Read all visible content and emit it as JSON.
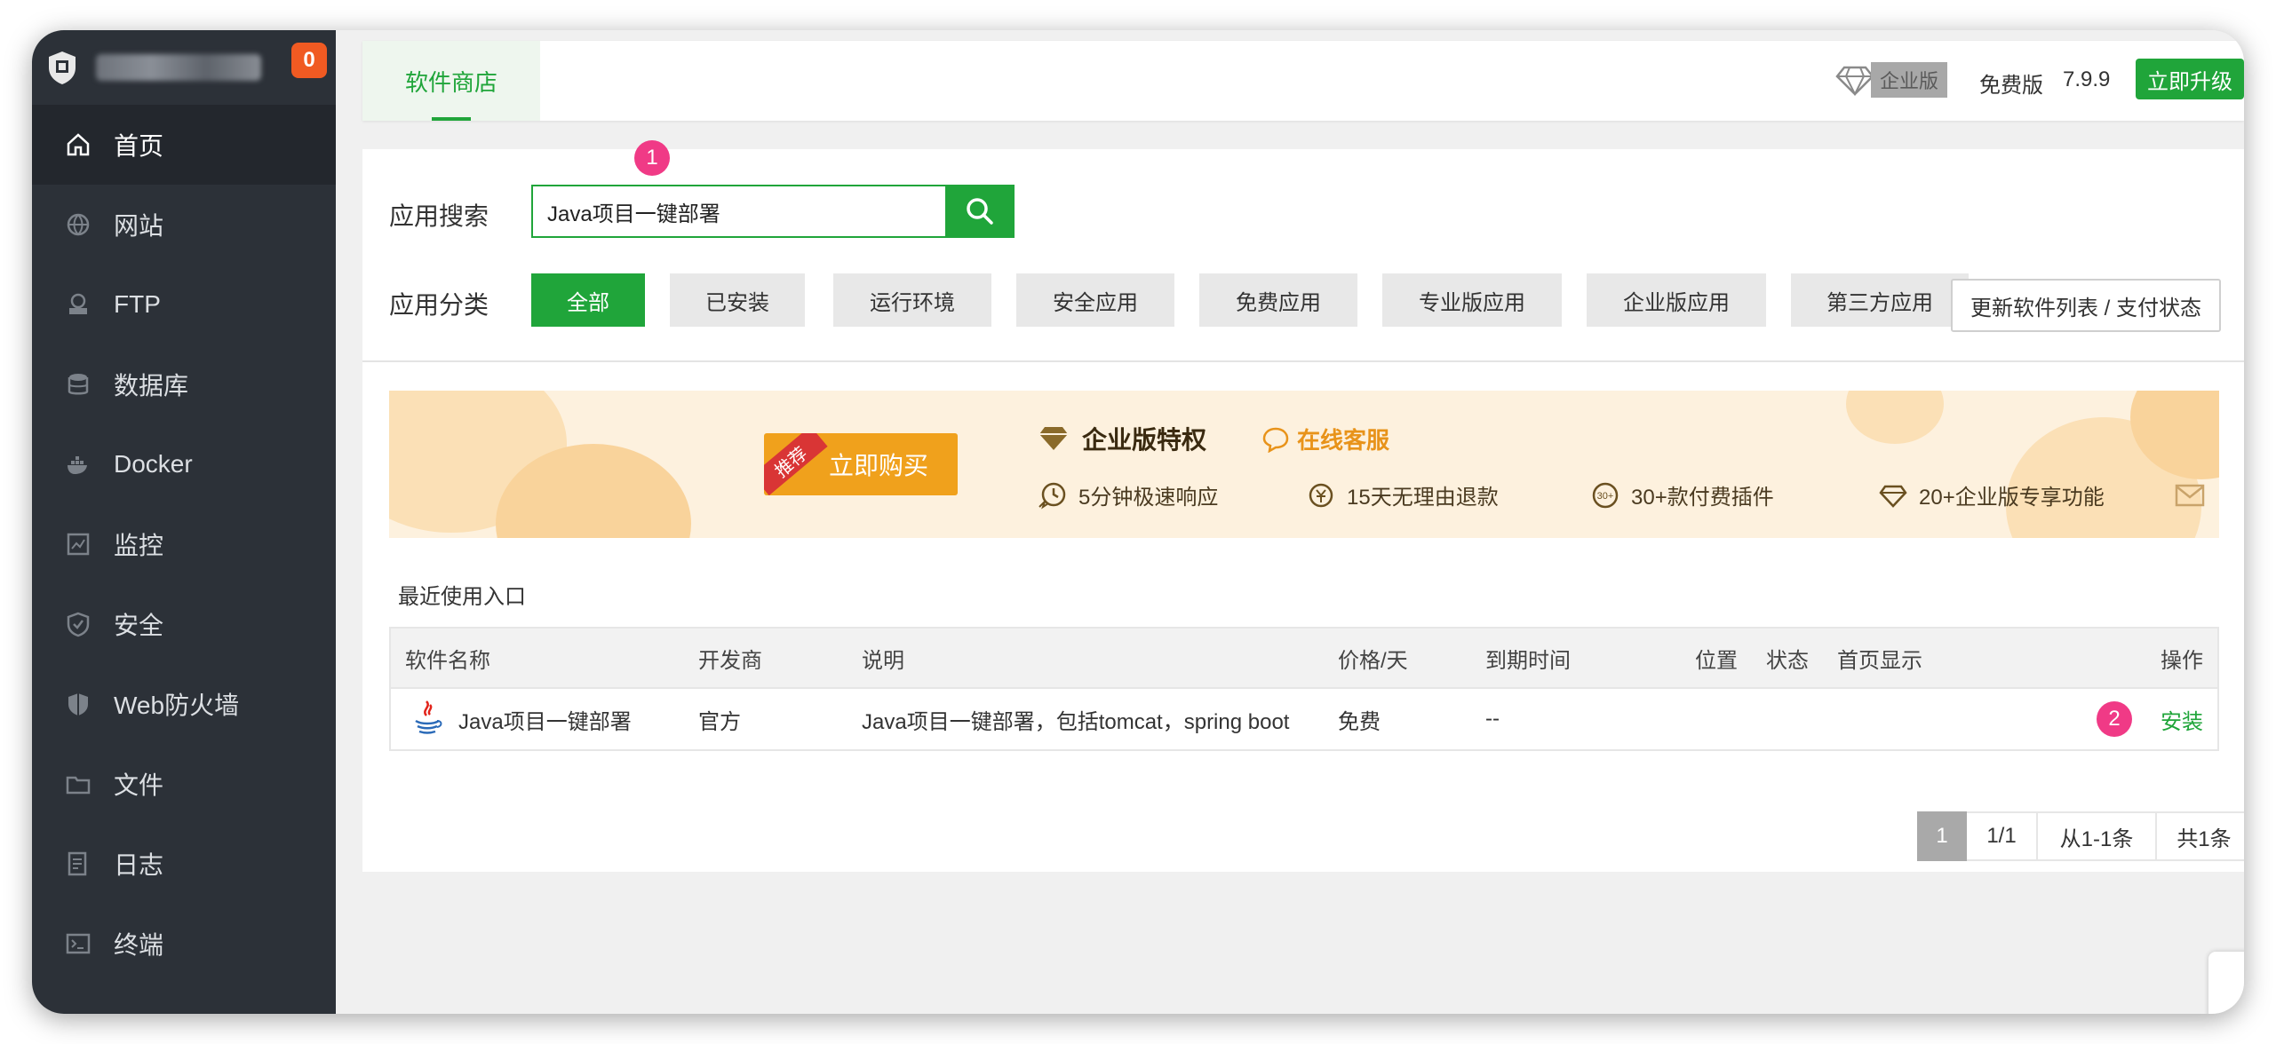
{
  "sidebar": {
    "badge": "0",
    "items": [
      {
        "label": "首页",
        "icon": "home-icon"
      },
      {
        "label": "网站",
        "icon": "globe-icon"
      },
      {
        "label": "FTP",
        "icon": "ftp-icon"
      },
      {
        "label": "数据库",
        "icon": "database-icon"
      },
      {
        "label": "Docker",
        "icon": "docker-icon"
      },
      {
        "label": "监控",
        "icon": "monitor-icon"
      },
      {
        "label": "安全",
        "icon": "shield-icon"
      },
      {
        "label": "Web防火墙",
        "icon": "firewall-icon"
      },
      {
        "label": "文件",
        "icon": "folder-icon"
      },
      {
        "label": "日志",
        "icon": "log-icon"
      },
      {
        "label": "终端",
        "icon": "terminal-icon"
      }
    ]
  },
  "topbar": {
    "tab": "软件商店",
    "edition": "企业版",
    "free": "免费版",
    "version": "7.9.9",
    "upgrade": "立即升级"
  },
  "search": {
    "label": "应用搜索",
    "value": "Java项目一键部署"
  },
  "categories": {
    "label": "应用分类",
    "items": [
      "全部",
      "已安装",
      "运行环境",
      "安全应用",
      "免费应用",
      "专业版应用",
      "企业版应用",
      "第三方应用"
    ],
    "refresh": "更新软件列表 / 支付状态"
  },
  "banner": {
    "ribbon": "推荐",
    "buy": "立即购买",
    "title": "企业版特权",
    "online": "在线客服",
    "features": [
      "5分钟极速响应",
      "15天无理由退款",
      "30+款付费插件",
      "20+企业版专享功能"
    ],
    "feature_icon_text": "30+"
  },
  "recent_label": "最近使用入口",
  "table": {
    "headers": [
      "软件名称",
      "开发商",
      "说明",
      "价格/天",
      "到期时间",
      "位置",
      "状态",
      "首页显示",
      "操作"
    ],
    "rows": [
      {
        "name": "Java项目一键部署",
        "dev": "官方",
        "desc": "Java项目一键部署，包括tomcat，spring boot",
        "price": "免费",
        "expire": "--",
        "action": "安装"
      }
    ]
  },
  "pager": [
    "1",
    "1/1",
    "从1-1条",
    "共1条"
  ],
  "markers": [
    "1",
    "2"
  ],
  "colors": {
    "accent": "#20a53a",
    "sidebar": "#2c3138",
    "marker": "#f03a86",
    "badge": "#f05a22"
  }
}
